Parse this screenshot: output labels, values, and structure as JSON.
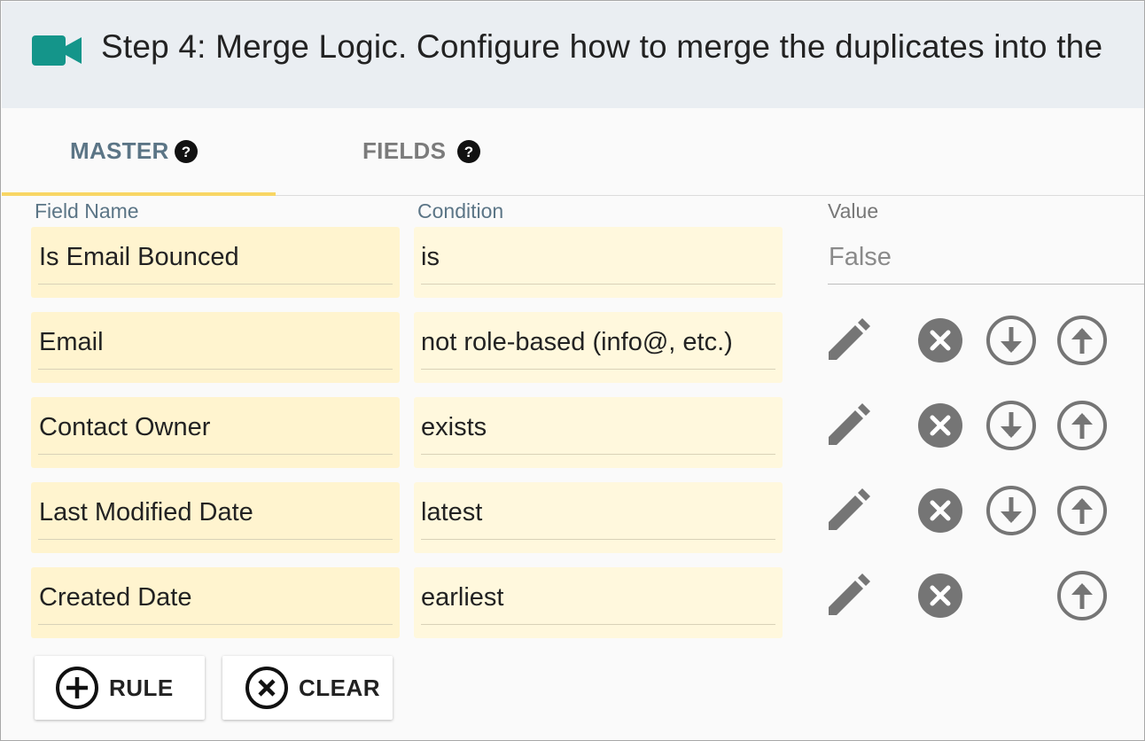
{
  "header": {
    "title": "Step 4: Merge Logic. Configure how to merge the duplicates into the",
    "icon": "video-camera-icon",
    "icon_color": "#14958a"
  },
  "tabs": [
    {
      "label": "MASTER",
      "active": true
    },
    {
      "label": "FIELDS",
      "active": false
    }
  ],
  "columns": {
    "field_name": "Field Name",
    "condition": "Condition",
    "value": "Value"
  },
  "rules": [
    {
      "field": "Is Email Bounced",
      "condition": "is",
      "value": "False"
    },
    {
      "field": "Email",
      "condition": "not role-based (info@, etc.)",
      "actions": [
        "edit",
        "remove",
        "move-down",
        "move-up"
      ]
    },
    {
      "field": "Contact Owner",
      "condition": "exists",
      "actions": [
        "edit",
        "remove",
        "move-down",
        "move-up"
      ]
    },
    {
      "field": "Last Modified Date",
      "condition": "latest",
      "actions": [
        "edit",
        "remove",
        "move-down",
        "move-up"
      ]
    },
    {
      "field": "Created Date",
      "condition": "earliest",
      "actions": [
        "edit",
        "remove",
        "move-up"
      ]
    }
  ],
  "buttons": {
    "add_rule": "RULE",
    "clear": "CLEAR"
  },
  "colors": {
    "accent_tab": "#f8d664",
    "field_bg": "#fff4cf",
    "icon_gray": "#757575"
  }
}
